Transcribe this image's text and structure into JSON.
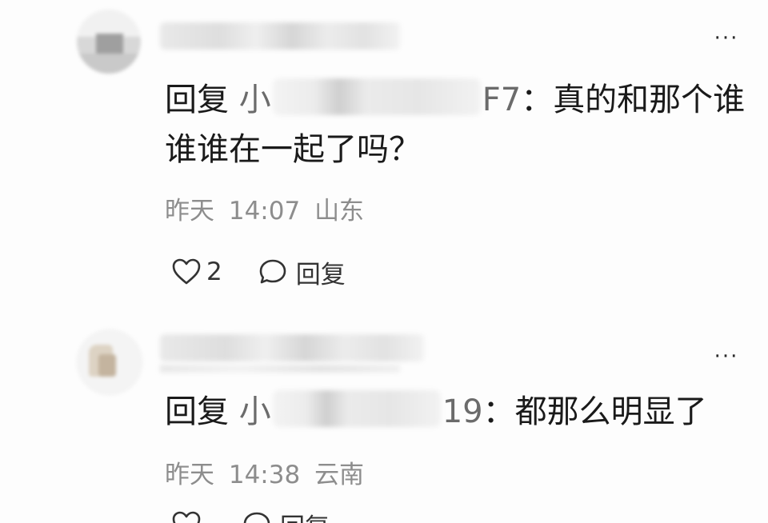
{
  "comments": [
    {
      "reply_prefix": "回复",
      "mention_start": "小",
      "mention_end": "F7",
      "separator": "：",
      "body": "真的和那个谁谁谁在一起了吗？",
      "date": "昨天",
      "time": "14:07",
      "location": "山东",
      "like_count": "2",
      "reply_label": "回复",
      "more_icon": "more-dots-icon"
    },
    {
      "reply_prefix": "回复",
      "mention_start": "小",
      "mention_end": "19",
      "separator": "：",
      "body": "都那么明显了",
      "date": "昨天",
      "time": "14:38",
      "location": "云南",
      "like_count": "",
      "reply_label": "回复",
      "more_icon": "more-dots-icon"
    }
  ],
  "colors": {
    "text_primary": "#1a1a1a",
    "text_meta": "#8d8d8d",
    "icon": "#333333",
    "background": "#fdfdfd"
  }
}
